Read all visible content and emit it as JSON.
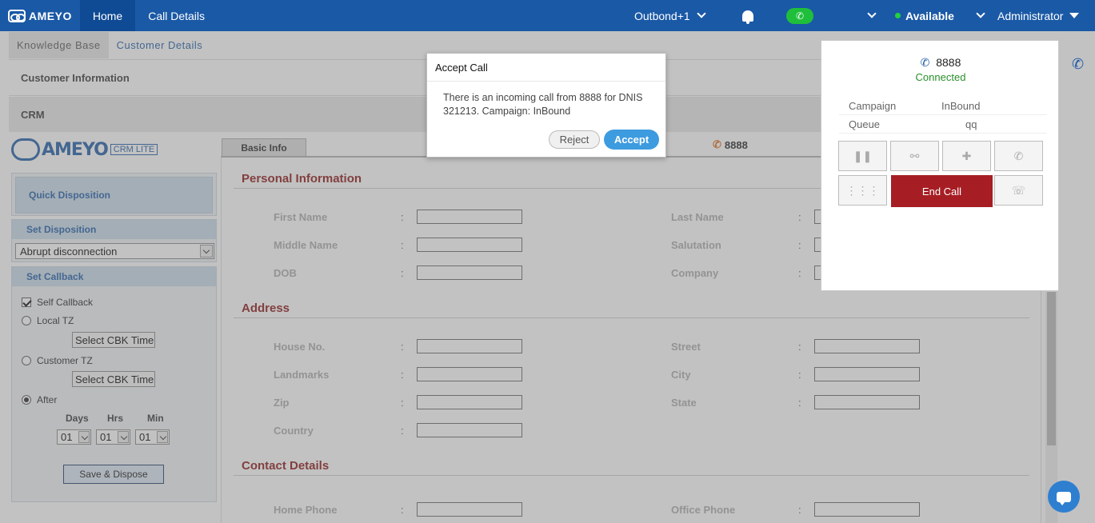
{
  "topbar": {
    "logo": "AMEYO",
    "tabs": [
      {
        "label": "Home"
      },
      {
        "label": "Call Details"
      }
    ],
    "campaign_selector": "Outbond+1",
    "status": "Available",
    "user": "Administrator"
  },
  "subtabs": [
    {
      "label": "Knowledge Base"
    },
    {
      "label": "Customer Details"
    }
  ],
  "sections": {
    "customer_info": "Customer Information",
    "crm": "CRM"
  },
  "crm_logo": {
    "brand": "AMEYO",
    "crm": "CRM",
    "lite": "LITE"
  },
  "disposition": {
    "quick_disposition": "Quick Disposition",
    "set_disposition": "Set Disposition",
    "selected": "Abrupt disconnection",
    "set_callback": "Set Callback",
    "self_callback": "Self Callback",
    "local_tz": "Local TZ",
    "customer_tz": "Customer TZ",
    "select_cbk_time": "Select CBK Time",
    "after": "After",
    "days_label": "Days",
    "hrs_label": "Hrs",
    "min_label": "Min",
    "days_value": "01",
    "hrs_value": "01",
    "min_value": "01",
    "save_button": "Save & Dispose"
  },
  "form": {
    "tab": "Basic Info",
    "phone": "8888",
    "sections": {
      "personal": "Personal Information",
      "address": "Address",
      "contact": "Contact Details"
    },
    "personal_left": [
      "First Name",
      "Middle Name",
      "DOB"
    ],
    "personal_right": [
      "Last Name",
      "Salutation",
      "Company"
    ],
    "address_left": [
      "House No.",
      "Landmarks",
      "Zip",
      "Country"
    ],
    "address_right": [
      "Street",
      "City",
      "State"
    ],
    "contact_left": [
      "Home Phone"
    ],
    "contact_right": [
      "Office Phone"
    ],
    "colon": ":"
  },
  "call_panel": {
    "number": "8888",
    "status": "Connected",
    "campaign_label": "Campaign",
    "campaign_value": "InBound",
    "queue_label": "Queue",
    "queue_value": "qq",
    "end_call": "End Call"
  },
  "dialog": {
    "title": "Accept Call",
    "message": "There is an incoming call from 8888 for DNIS 321213. Campaign: InBound",
    "reject": "Reject",
    "accept": "Accept"
  }
}
